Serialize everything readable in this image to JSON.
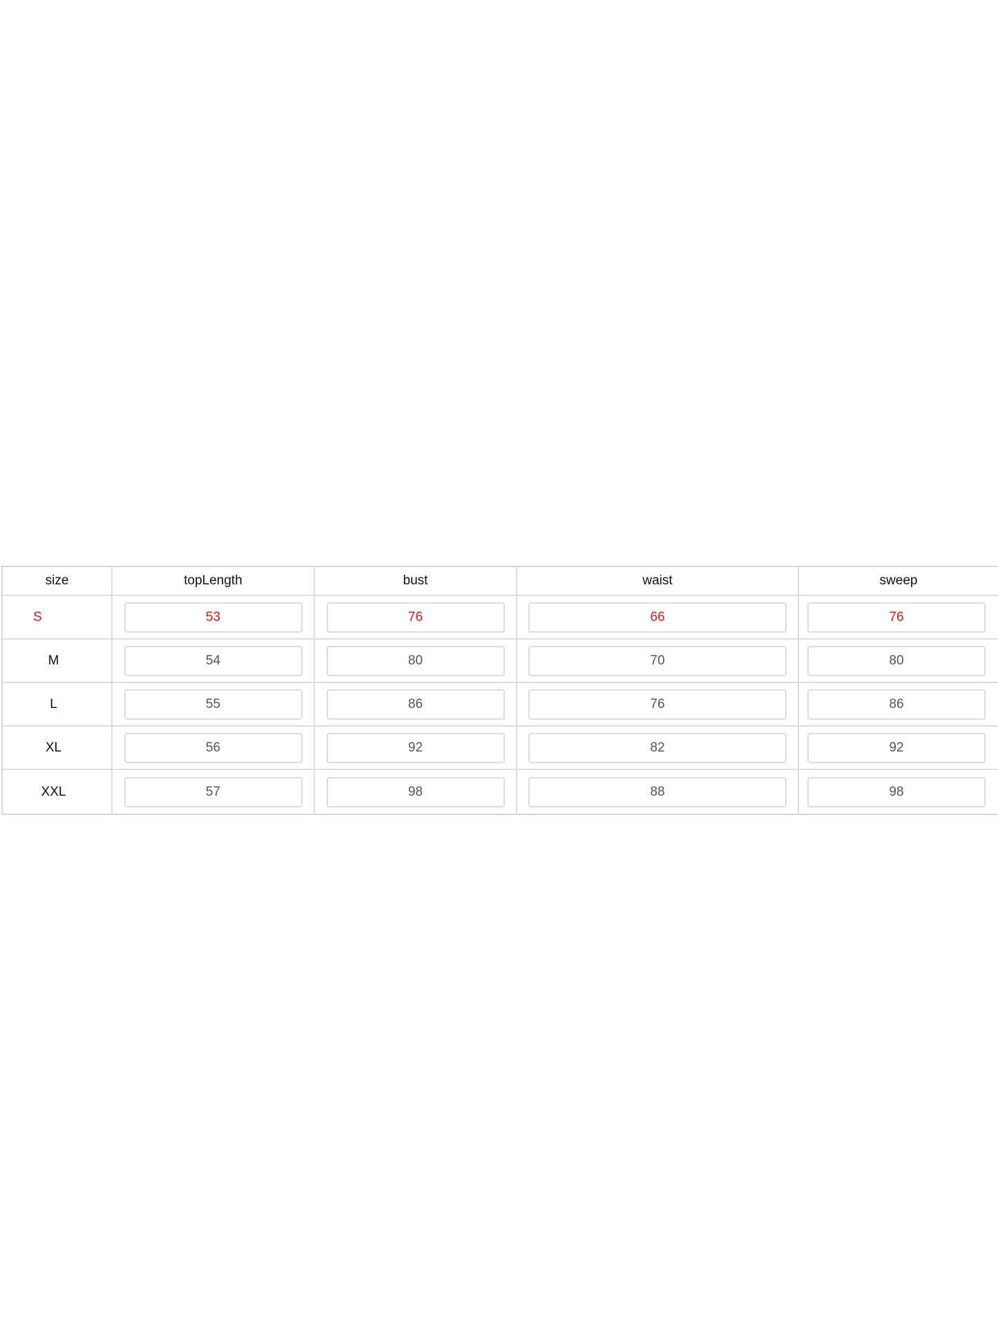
{
  "table": {
    "headers": [
      "size",
      "topLength",
      "bust",
      "waist",
      "sweep"
    ],
    "rows": [
      {
        "size": "S",
        "topLength": "53",
        "bust": "76",
        "waist": "66",
        "sweep": "76",
        "selected": true
      },
      {
        "size": "M",
        "topLength": "54",
        "bust": "80",
        "waist": "70",
        "sweep": "80",
        "selected": false
      },
      {
        "size": "L",
        "topLength": "55",
        "bust": "86",
        "waist": "76",
        "sweep": "86",
        "selected": false
      },
      {
        "size": "XL",
        "topLength": "56",
        "bust": "92",
        "waist": "82",
        "sweep": "92",
        "selected": false
      },
      {
        "size": "XXL",
        "topLength": "57",
        "bust": "98",
        "waist": "88",
        "sweep": "98",
        "selected": false
      }
    ]
  },
  "colors": {
    "selected_text": "#e01818",
    "value_text": "#555555",
    "border": "#dcdcdc"
  }
}
